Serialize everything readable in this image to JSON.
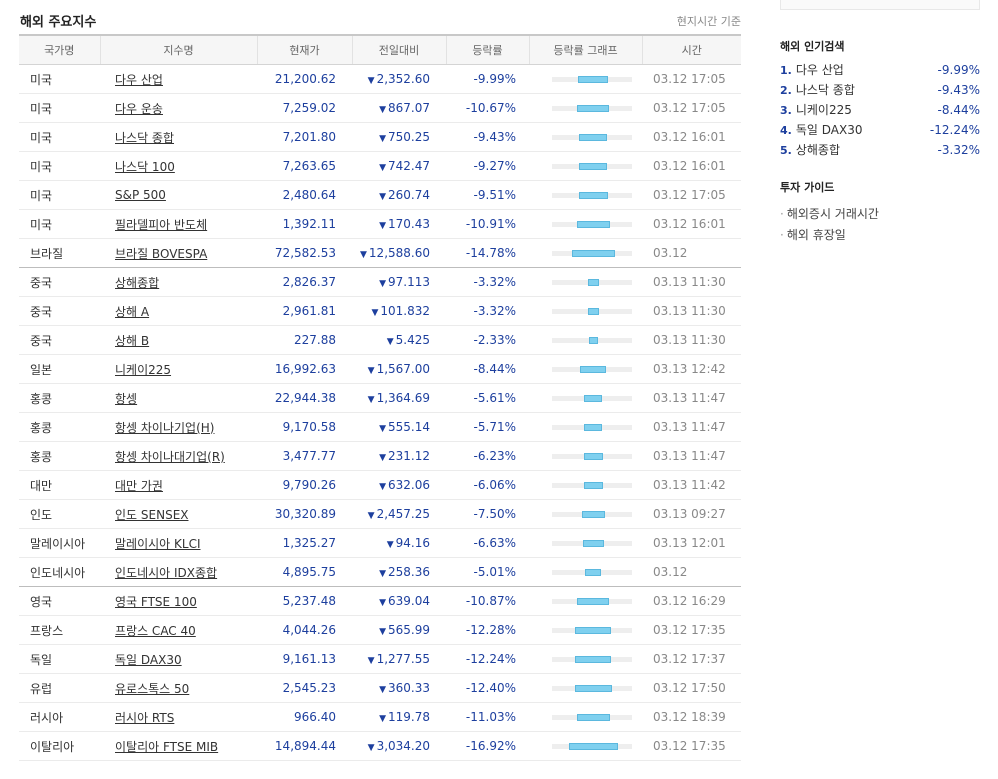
{
  "header": {
    "title": "해외 주요지수",
    "basis": "현지시간 기준"
  },
  "table": {
    "columns": [
      "국가명",
      "지수명",
      "현재가",
      "전일대비",
      "등락률",
      "등락률 그래프",
      "시간"
    ],
    "rows": [
      {
        "country": "미국",
        "name": "다우 산업",
        "price": "21,200.62",
        "change": "2,352.60",
        "rate": "-9.99%",
        "bar": -9.99,
        "time": "03.12 17:05"
      },
      {
        "country": "미국",
        "name": "다우 운송",
        "price": "7,259.02",
        "change": "867.07",
        "rate": "-10.67%",
        "bar": -10.67,
        "time": "03.12 17:05"
      },
      {
        "country": "미국",
        "name": "나스닥 종합",
        "price": "7,201.80",
        "change": "750.25",
        "rate": "-9.43%",
        "bar": -9.43,
        "time": "03.12 16:01"
      },
      {
        "country": "미국",
        "name": "나스닥 100",
        "price": "7,263.65",
        "change": "742.47",
        "rate": "-9.27%",
        "bar": -9.27,
        "time": "03.12 16:01"
      },
      {
        "country": "미국",
        "name": "S&P 500",
        "price": "2,480.64",
        "change": "260.74",
        "rate": "-9.51%",
        "bar": -9.51,
        "time": "03.12 17:05"
      },
      {
        "country": "미국",
        "name": "필라델피아 반도체",
        "price": "1,392.11",
        "change": "170.43",
        "rate": "-10.91%",
        "bar": -10.91,
        "time": "03.12 16:01"
      },
      {
        "country": "브라질",
        "name": "브라질 BOVESPA",
        "price": "72,582.53",
        "change": "12,588.60",
        "rate": "-14.78%",
        "bar": -14.78,
        "time": "03.12",
        "groupEnd": true
      },
      {
        "country": "중국",
        "name": "상해종합",
        "price": "2,826.37",
        "change": "97.113",
        "rate": "-3.32%",
        "bar": -3.32,
        "time": "03.13 11:30"
      },
      {
        "country": "중국",
        "name": "상해 A",
        "price": "2,961.81",
        "change": "101.832",
        "rate": "-3.32%",
        "bar": -3.32,
        "time": "03.13 11:30"
      },
      {
        "country": "중국",
        "name": "상해 B",
        "price": "227.88",
        "change": "5.425",
        "rate": "-2.33%",
        "bar": -2.33,
        "time": "03.13 11:30"
      },
      {
        "country": "일본",
        "name": "니케이225",
        "price": "16,992.63",
        "change": "1,567.00",
        "rate": "-8.44%",
        "bar": -8.44,
        "time": "03.13 12:42"
      },
      {
        "country": "홍콩",
        "name": "항셍",
        "price": "22,944.38",
        "change": "1,364.69",
        "rate": "-5.61%",
        "bar": -5.61,
        "time": "03.13 11:47"
      },
      {
        "country": "홍콩",
        "name": "항셍 차이나기업(H)",
        "price": "9,170.58",
        "change": "555.14",
        "rate": "-5.71%",
        "bar": -5.71,
        "time": "03.13 11:47"
      },
      {
        "country": "홍콩",
        "name": "항셍 차이나대기업(R)",
        "price": "3,477.77",
        "change": "231.12",
        "rate": "-6.23%",
        "bar": -6.23,
        "time": "03.13 11:47"
      },
      {
        "country": "대만",
        "name": "대만 가권",
        "price": "9,790.26",
        "change": "632.06",
        "rate": "-6.06%",
        "bar": -6.06,
        "time": "03.13 11:42"
      },
      {
        "country": "인도",
        "name": "인도 SENSEX",
        "price": "30,320.89",
        "change": "2,457.25",
        "rate": "-7.50%",
        "bar": -7.5,
        "time": "03.13 09:27"
      },
      {
        "country": "말레이시아",
        "name": "말레이시아 KLCI",
        "price": "1,325.27",
        "change": "94.16",
        "rate": "-6.63%",
        "bar": -6.63,
        "time": "03.13 12:01"
      },
      {
        "country": "인도네시아",
        "name": "인도네시아 IDX종합",
        "price": "4,895.75",
        "change": "258.36",
        "rate": "-5.01%",
        "bar": -5.01,
        "time": "03.12",
        "groupEnd": true
      },
      {
        "country": "영국",
        "name": "영국 FTSE 100",
        "price": "5,237.48",
        "change": "639.04",
        "rate": "-10.87%",
        "bar": -10.87,
        "time": "03.12 16:29"
      },
      {
        "country": "프랑스",
        "name": "프랑스 CAC 40",
        "price": "4,044.26",
        "change": "565.99",
        "rate": "-12.28%",
        "bar": -12.28,
        "time": "03.12 17:35"
      },
      {
        "country": "독일",
        "name": "독일 DAX30",
        "price": "9,161.13",
        "change": "1,277.55",
        "rate": "-12.24%",
        "bar": -12.24,
        "time": "03.12 17:37"
      },
      {
        "country": "유럽",
        "name": "유로스톡스 50",
        "price": "2,545.23",
        "change": "360.33",
        "rate": "-12.40%",
        "bar": -12.4,
        "time": "03.12 17:50"
      },
      {
        "country": "러시아",
        "name": "러시아 RTS",
        "price": "966.40",
        "change": "119.78",
        "rate": "-11.03%",
        "bar": -11.03,
        "time": "03.12 18:39"
      },
      {
        "country": "이탈리아",
        "name": "이탈리아 FTSE MIB",
        "price": "14,894.44",
        "change": "3,034.20",
        "rate": "-16.92%",
        "bar": -16.92,
        "time": "03.12 17:35"
      }
    ]
  },
  "sidebar": {
    "popular_title": "해외 인기검색",
    "popular": [
      {
        "rank": "1.",
        "name": "다우 산업",
        "rate": "-9.99%"
      },
      {
        "rank": "2.",
        "name": "나스닥 종합",
        "rate": "-9.43%"
      },
      {
        "rank": "3.",
        "name": "니케이225",
        "rate": "-8.44%"
      },
      {
        "rank": "4.",
        "name": "독일 DAX30",
        "rate": "-12.24%"
      },
      {
        "rank": "5.",
        "name": "상해종합",
        "rate": "-3.32%"
      }
    ],
    "guide_title": "투자 가이드",
    "guide": [
      "해외증시 거래시간",
      "해외 휴장일"
    ]
  },
  "colors": {
    "down": "#1d3f9e",
    "bar_fill": "#7fd0ef",
    "bar_track": "#eeeeee"
  },
  "icons": {
    "down_arrow": "down-triangle-icon"
  }
}
